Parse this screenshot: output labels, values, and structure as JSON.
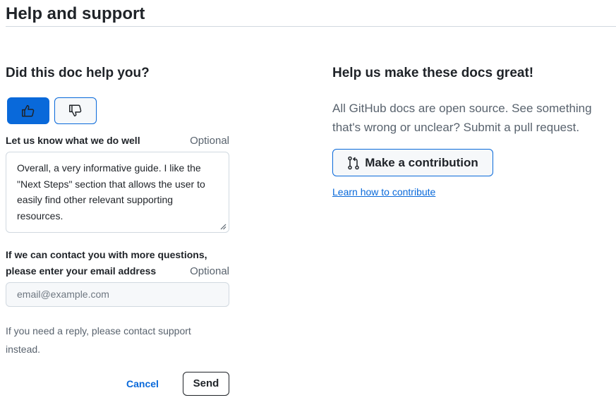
{
  "page": {
    "title": "Help and support"
  },
  "feedback": {
    "heading": "Did this doc help you?",
    "thumbs_up_icon": "thumbs-up-icon",
    "thumbs_down_icon": "thumbs-down-icon",
    "selected_vote": "yes",
    "comment_label": "Let us know what we do well",
    "comment_optional": "Optional",
    "comment_value": "Overall, a very informative guide. I like the \"Next Steps\" section that allows the user to easily find other relevant supporting resources.",
    "email_label_line1": "If we can contact you with more questions,",
    "email_label_line2": "please enter your email address",
    "email_optional": "Optional",
    "email_placeholder": "email@example.com",
    "email_value": "",
    "support_note": "If you need a reply, please contact support instead.",
    "cancel_label": "Cancel",
    "send_label": "Send"
  },
  "contribute": {
    "heading": "Help us make these docs great!",
    "description": "All GitHub docs are open source. See something that's wrong or unclear? Submit a pull request.",
    "button_icon": "git-pull-request-icon",
    "button_label": "Make a contribution",
    "learn_link": "Learn how to contribute"
  },
  "colors": {
    "accent": "#0969da",
    "text": "#1f2328",
    "muted": "#59636e",
    "border": "#d1d9e0",
    "input_bg": "#f6f8fa"
  }
}
